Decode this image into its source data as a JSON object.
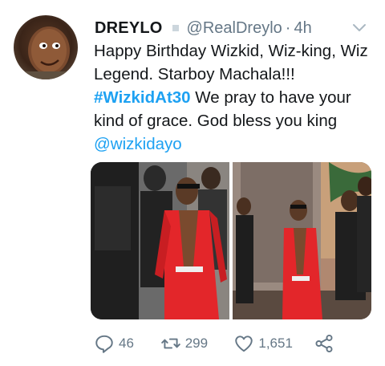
{
  "tweet": {
    "display_name": "DREYLO",
    "handle": "@RealDreylo",
    "separator": "·",
    "time": "4h",
    "text_line1": "Happy Birthday Wizkid, Wiz-king, Wiz Legend. Starboy Machala!!!",
    "hashtag": "#WizkidAt30",
    "text_after_hashtag": " We pray to have your kind of grace. God bless you king",
    "mention": "@wizkidayo"
  },
  "actions": {
    "reply_count": "46",
    "retweet_count": "299",
    "like_count": "1,651"
  },
  "icons": {
    "reply": "reply-icon",
    "retweet": "retweet-icon",
    "like": "heart-icon",
    "share": "share-icon",
    "menu": "chevron-down-icon"
  },
  "colors": {
    "link": "#1da1f2",
    "secondary_text": "#657786",
    "outfit": "#e3262a"
  }
}
